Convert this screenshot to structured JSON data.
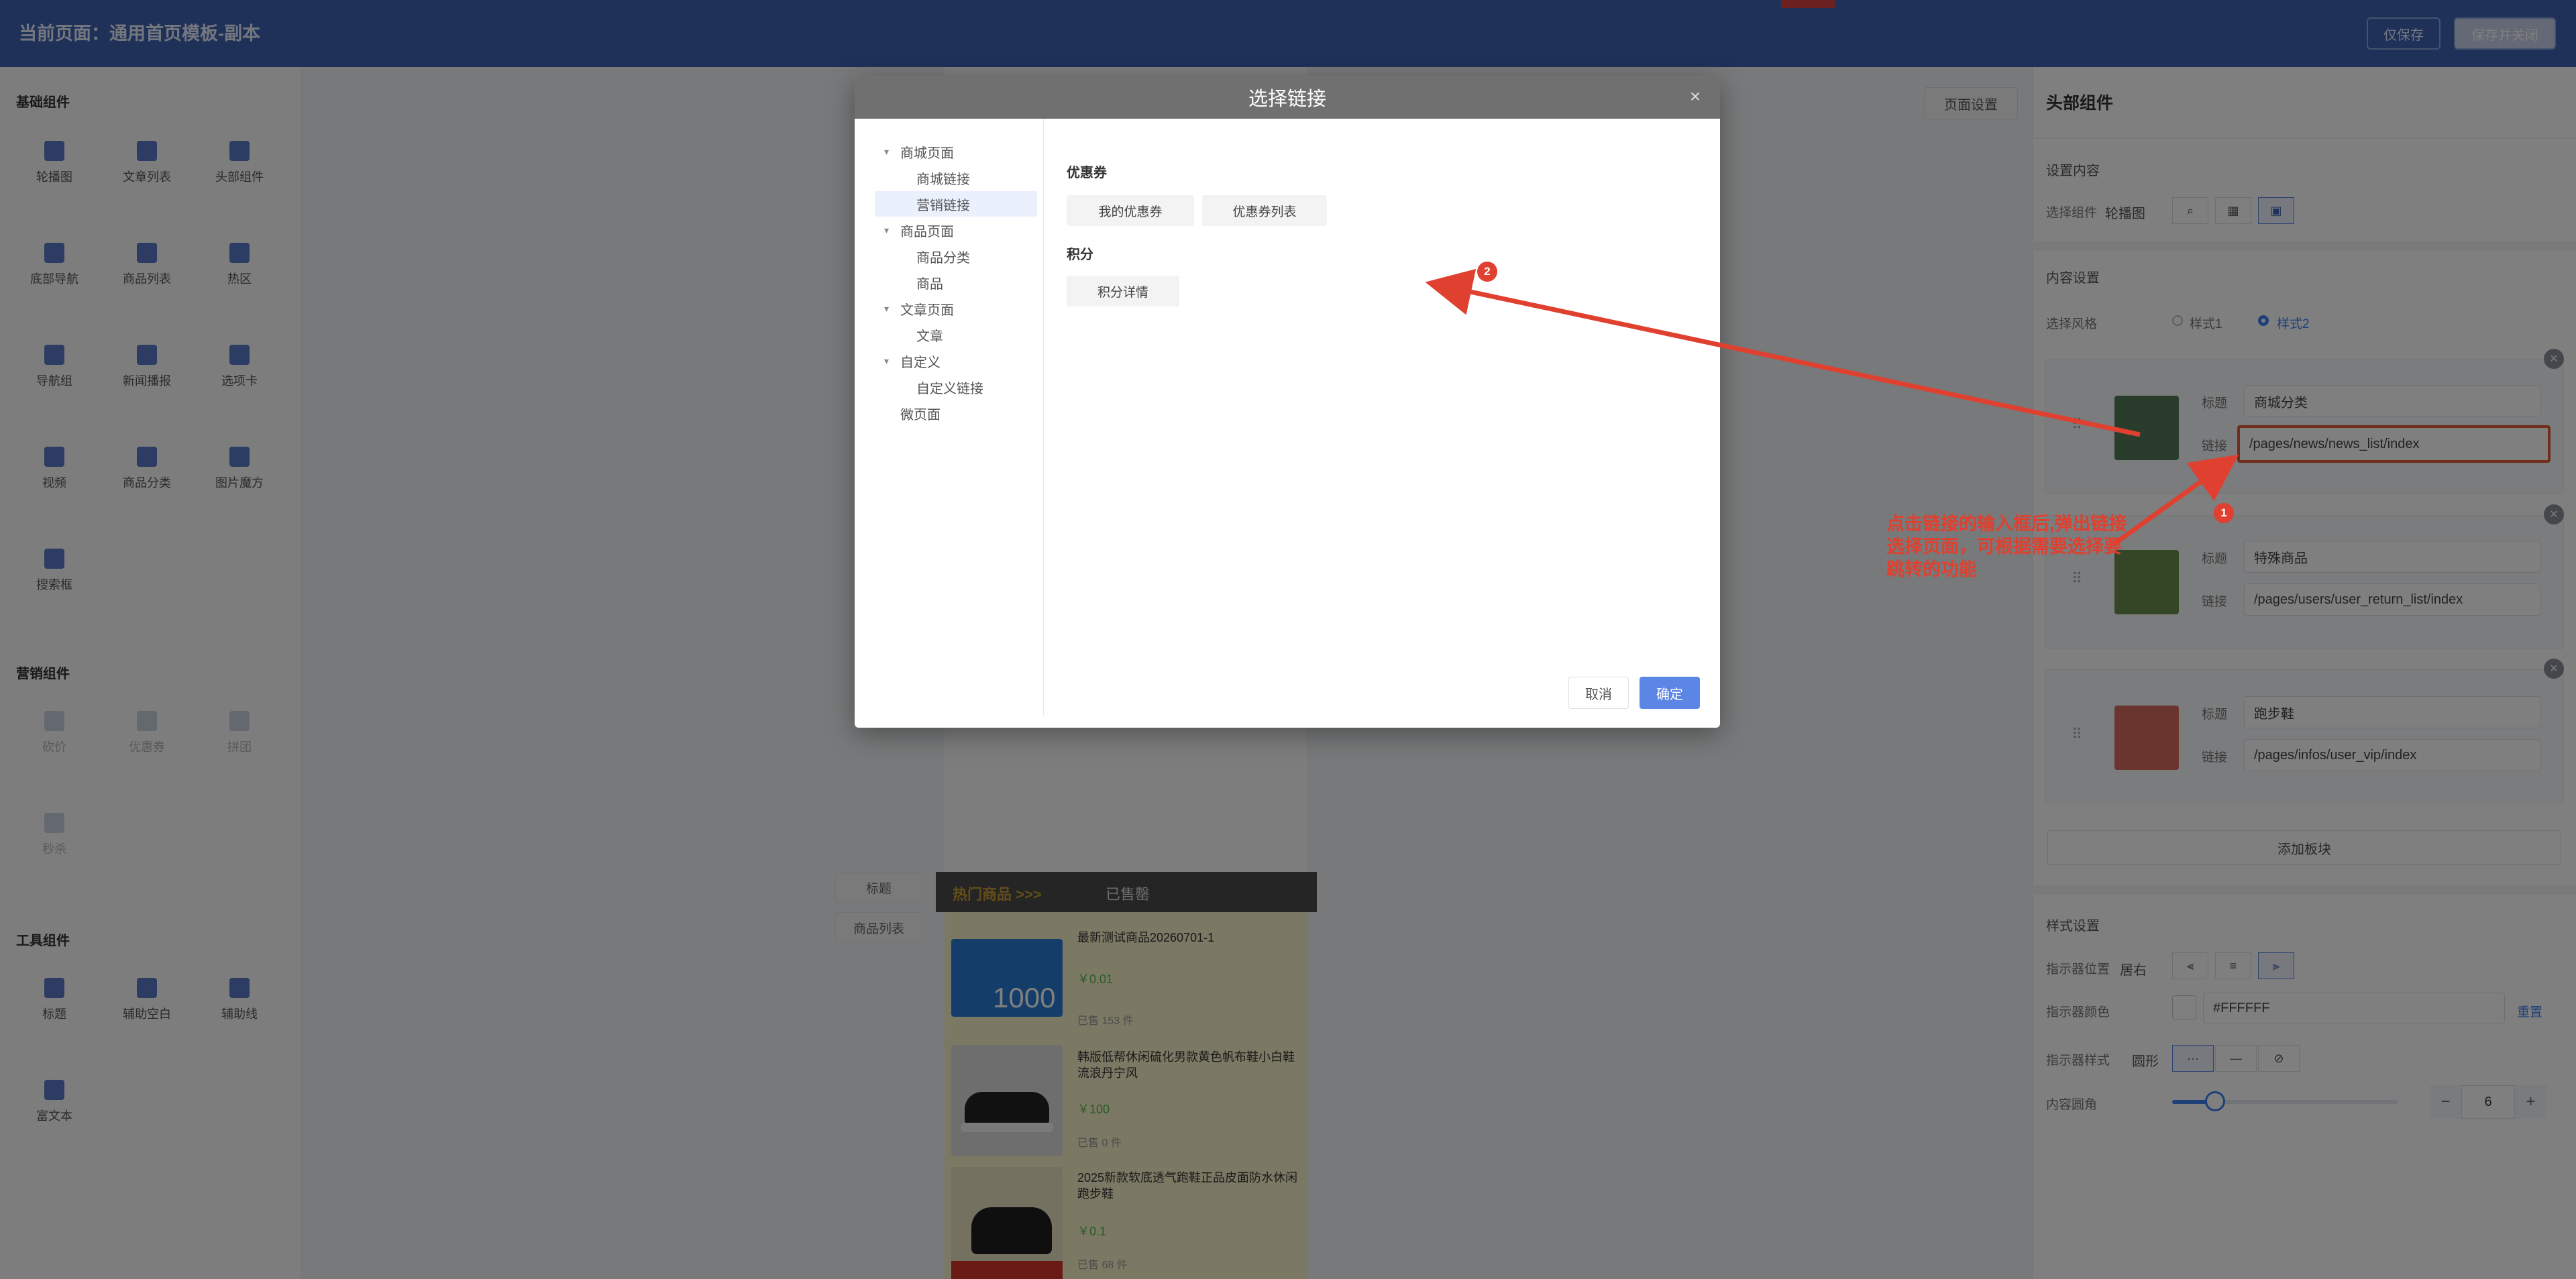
{
  "topbar": {
    "title": "当前页面：通用首页模板-副本",
    "save": "仅保存",
    "save_close": "保存并关闭"
  },
  "left": {
    "sections": [
      {
        "title": "基础组件",
        "items": [
          "轮播图",
          "文章列表",
          "头部组件",
          "底部导航",
          "商品列表",
          "热区",
          "导航组",
          "新闻播报",
          "选项卡",
          "视频",
          "商品分类",
          "图片魔方",
          "搜索框"
        ]
      },
      {
        "title": "营销组件",
        "items": [
          "砍价",
          "优惠券",
          "拼团",
          "秒杀"
        ]
      },
      {
        "title": "工具组件",
        "items": [
          "标题",
          "辅助空白",
          "辅助线",
          "富文本"
        ]
      }
    ]
  },
  "canvas": {
    "page_settings": "页面设置",
    "tags": [
      "标题",
      "商品列表"
    ],
    "hot_bar": {
      "title": "热门商品 >>>",
      "tab": "已售罄"
    },
    "products": [
      {
        "name": "最新测试商品20260701-1",
        "price": "￥0.01",
        "sold": "已售 153 件",
        "thumb_text": "1000"
      },
      {
        "name": "韩版低帮休闲硫化男款黄色帆布鞋小白鞋流浪丹宁风",
        "price": "￥100",
        "sold": "已售 0 件"
      },
      {
        "name": "2025新款软底透气跑鞋正品皮面防水休闲跑步鞋",
        "price": "￥0.1",
        "sold": "已售 68 件"
      }
    ]
  },
  "right": {
    "title": "头部组件",
    "set_content": "设置内容",
    "select_component_label": "选择组件",
    "select_component_value": "轮播图",
    "content_settings": "内容设置",
    "style_label": "选择风格",
    "style1": "样式1",
    "style2": "样式2",
    "title_label": "标题",
    "link_label": "链接",
    "items": [
      {
        "title": "商城分类",
        "link": "/pages/news/news_list/index"
      },
      {
        "title": "特殊商品",
        "link": "/pages/users/user_return_list/index"
      },
      {
        "title": "跑步鞋",
        "link": "/pages/infos/user_vip/index"
      }
    ],
    "add_block": "添加板块",
    "style_settings": "样式设置",
    "indicator_pos_label": "指示器位置",
    "indicator_pos_value": "居右",
    "indicator_color_label": "指示器颜色",
    "indicator_color_value": "#FFFFFF",
    "reset": "重置",
    "indicator_style_label": "指示器样式",
    "indicator_style_value": "圆形",
    "radius_label": "内容圆角",
    "radius_value": "6",
    "radius_level": 0.19,
    "minus": "−",
    "plus": "+"
  },
  "modal": {
    "title": "选择链接",
    "close": "×",
    "tree": [
      {
        "label": "商城页面",
        "level": 0,
        "caret": true
      },
      {
        "label": "商城链接",
        "level": 1
      },
      {
        "label": "营销链接",
        "level": 1,
        "selected": true
      },
      {
        "label": "商品页面",
        "level": 0,
        "caret": true
      },
      {
        "label": "商品分类",
        "level": 1
      },
      {
        "label": "商品",
        "level": 1
      },
      {
        "label": "文章页面",
        "level": 0,
        "caret": true
      },
      {
        "label": "文章",
        "level": 1
      },
      {
        "label": "自定义",
        "level": 0,
        "caret": true
      },
      {
        "label": "自定义链接",
        "level": 1
      },
      {
        "label": "微页面",
        "level": 0
      }
    ],
    "groups": [
      {
        "title": "优惠券",
        "links": [
          "我的优惠券",
          "优惠券列表"
        ]
      },
      {
        "title": "积分",
        "links": [
          "积分详情"
        ]
      }
    ],
    "cancel": "取消",
    "confirm": "确定"
  },
  "annotation": {
    "badge1": "1",
    "badge2": "2",
    "text": "点击链接的输入框后,弹出链接选择页面，可根据需要选择要跳转的功能",
    "color": "#e0402f"
  },
  "colors": {
    "brand": "#3f63b3",
    "primary": "#5b86e5",
    "price": "#52b848"
  }
}
